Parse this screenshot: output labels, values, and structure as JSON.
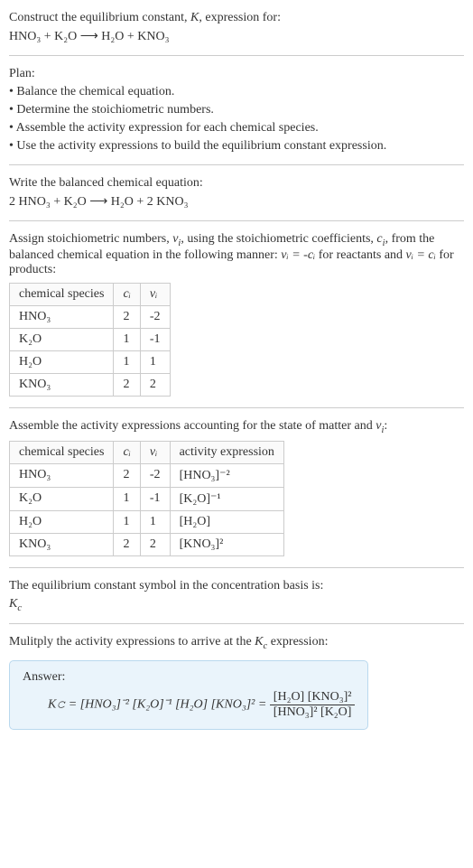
{
  "chart_data": [
    {
      "type": "table",
      "title": "stoichiometric numbers",
      "headers": [
        "chemical species",
        "cᵢ",
        "νᵢ"
      ],
      "rows": [
        [
          "HNO₃",
          2,
          -2
        ],
        [
          "K₂O",
          1,
          -1
        ],
        [
          "H₂O",
          1,
          1
        ],
        [
          "KNO₃",
          2,
          2
        ]
      ]
    },
    {
      "type": "table",
      "title": "activity expressions",
      "headers": [
        "chemical species",
        "cᵢ",
        "νᵢ",
        "activity expression"
      ],
      "rows": [
        [
          "HNO₃",
          2,
          -2,
          "[HNO₃]⁻²"
        ],
        [
          "K₂O",
          1,
          -1,
          "[K₂O]⁻¹"
        ],
        [
          "H₂O",
          1,
          1,
          "[H₂O]"
        ],
        [
          "KNO₃",
          2,
          2,
          "[KNO₃]²"
        ]
      ]
    }
  ],
  "header": {
    "line1a": "Construct the equilibrium constant, ",
    "line1b": ", expression for:",
    "eq": "HNO₃ + K₂O  ⟶  H₂O + KNO₃"
  },
  "plan": {
    "title": "Plan:",
    "b1": "• Balance the chemical equation.",
    "b2": "• Determine the stoichiometric numbers.",
    "b3": "• Assemble the activity expression for each chemical species.",
    "b4": "• Use the activity expressions to build the equilibrium constant expression."
  },
  "balanced": {
    "intro": "Write the balanced chemical equation:",
    "eq": "2 HNO₃ + K₂O  ⟶  H₂O + 2 KNO₃"
  },
  "assign": {
    "p1": "Assign stoichiometric numbers, ",
    "p2": ", using the stoichiometric coefficients, ",
    "p3": ", from the balanced chemical equation in the following manner: ",
    "p4": " for reactants and ",
    "p5": " for products:"
  },
  "table1": {
    "h1": "chemical species",
    "h2": "cᵢ",
    "h3": "νᵢ",
    "r1c1": "HNO₃",
    "r1c2": "2",
    "r1c3": "-2",
    "r2c1": "K₂O",
    "r2c2": "1",
    "r2c3": "-1",
    "r3c1": "H₂O",
    "r3c2": "1",
    "r3c3": "1",
    "r4c1": "KNO₃",
    "r4c2": "2",
    "r4c3": "2"
  },
  "assemble": {
    "p1": "Assemble the activity expressions accounting for the state of matter and ",
    "p2": ":"
  },
  "table2": {
    "h1": "chemical species",
    "h2": "cᵢ",
    "h3": "νᵢ",
    "h4": "activity expression",
    "r1c1": "HNO₃",
    "r1c2": "2",
    "r1c3": "-2",
    "r1c4": "[HNO₃]⁻²",
    "r2c1": "K₂O",
    "r2c2": "1",
    "r2c3": "-1",
    "r2c4": "[K₂O]⁻¹",
    "r3c1": "H₂O",
    "r3c2": "1",
    "r3c3": "1",
    "r3c4": "[H₂O]",
    "r4c1": "KNO₃",
    "r4c2": "2",
    "r4c3": "2",
    "r4c4": "[KNO₃]²"
  },
  "symbol": {
    "intro": "The equilibrium constant symbol in the concentration basis is:",
    "val": "K𝚌"
  },
  "multiply": {
    "p1": "Mulitply the activity expressions to arrive at the ",
    "p2": " expression:"
  },
  "answer": {
    "label": "Answer:",
    "lhs": "K𝚌 = [HNO₃]⁻² [K₂O]⁻¹ [H₂O] [KNO₃]² = ",
    "num": "[H₂O] [KNO₃]²",
    "den": "[HNO₃]² [K₂O]"
  },
  "sym": {
    "K": "K",
    "Kc_sub": "c",
    "nu": "ν",
    "nu_sub": "i",
    "c": "c",
    "c_sub": "i",
    "eq_react": "νᵢ = -cᵢ",
    "eq_prod": "νᵢ = cᵢ"
  }
}
